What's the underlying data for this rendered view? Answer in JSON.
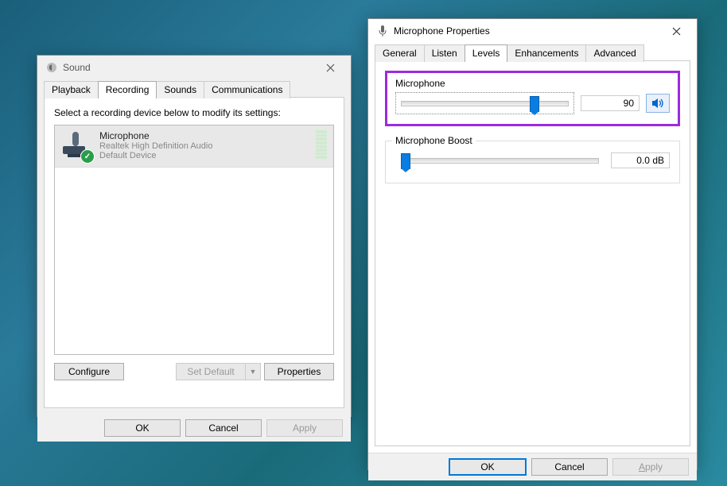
{
  "sound_window": {
    "title": "Sound",
    "tabs": [
      "Playback",
      "Recording",
      "Sounds",
      "Communications"
    ],
    "active_tab": 1,
    "instructions": "Select a recording device below to modify its settings:",
    "device": {
      "name": "Microphone",
      "description": "Realtek High Definition Audio",
      "status": "Default Device"
    },
    "buttons": {
      "configure": "Configure",
      "set_default": "Set Default",
      "properties": "Properties",
      "ok": "OK",
      "cancel": "Cancel",
      "apply": "Apply"
    }
  },
  "mic_window": {
    "title": "Microphone Properties",
    "tabs": [
      "General",
      "Listen",
      "Levels",
      "Enhancements",
      "Advanced"
    ],
    "active_tab": 2,
    "microphone": {
      "label": "Microphone",
      "value": "90",
      "slider_pct": 80
    },
    "boost": {
      "label": "Microphone Boost",
      "value": "0.0 dB",
      "slider_pct": 2
    },
    "buttons": {
      "ok": "OK",
      "cancel": "Cancel",
      "apply": "Apply"
    }
  }
}
